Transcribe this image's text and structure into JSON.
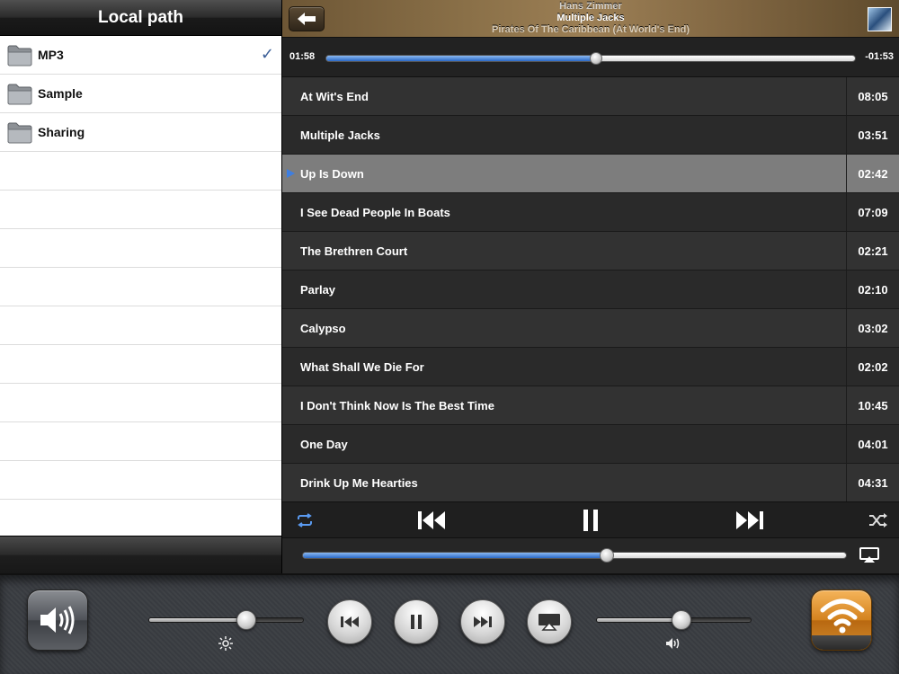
{
  "left_panel": {
    "title": "Local path",
    "folders": [
      {
        "label": "MP3",
        "selected": true
      },
      {
        "label": "Sample",
        "selected": false
      },
      {
        "label": "Sharing",
        "selected": false
      }
    ],
    "check_mark": "✓"
  },
  "now_playing": {
    "artist": "Hans Zimmer",
    "song": "Multiple Jacks",
    "album": "Pirates Of The Caribbean (At World's End)",
    "elapsed": "01:58",
    "remaining": "-01:53",
    "progress_fraction": 0.51
  },
  "tracks": [
    {
      "title": "At Wit's End",
      "duration": "08:05"
    },
    {
      "title": "Multiple Jacks",
      "duration": "03:51"
    },
    {
      "title": "Up Is Down",
      "duration": "02:42"
    },
    {
      "title": "I See Dead People In Boats",
      "duration": "07:09"
    },
    {
      "title": "The Brethren Court",
      "duration": "02:21"
    },
    {
      "title": "Parlay",
      "duration": "02:10"
    },
    {
      "title": "Calypso",
      "duration": "03:02"
    },
    {
      "title": "What Shall We Die For",
      "duration": "02:02"
    },
    {
      "title": "I Don't Think Now Is The Best Time",
      "duration": "10:45"
    },
    {
      "title": "One Day",
      "duration": "04:01"
    },
    {
      "title": "Drink Up Me Hearties",
      "duration": "04:31"
    }
  ],
  "playing_track_index": 2,
  "transport": {
    "icons": [
      "repeat-icon",
      "previous-track-icon",
      "pause-icon",
      "next-track-icon",
      "shuffle-icon"
    ],
    "accent_color": "#3e7ee0"
  },
  "volume": {
    "level_fraction": 0.56,
    "icon": "airplay-icon"
  },
  "multitask_bar": {
    "mute_icon": "speaker-icon",
    "brightness_fraction": 0.63,
    "system_volume_fraction": 0.55,
    "buttons": [
      "previous-track-icon",
      "pause-icon",
      "next-track-icon",
      "airplay-icon"
    ],
    "app_icon": "wifi-icon"
  }
}
